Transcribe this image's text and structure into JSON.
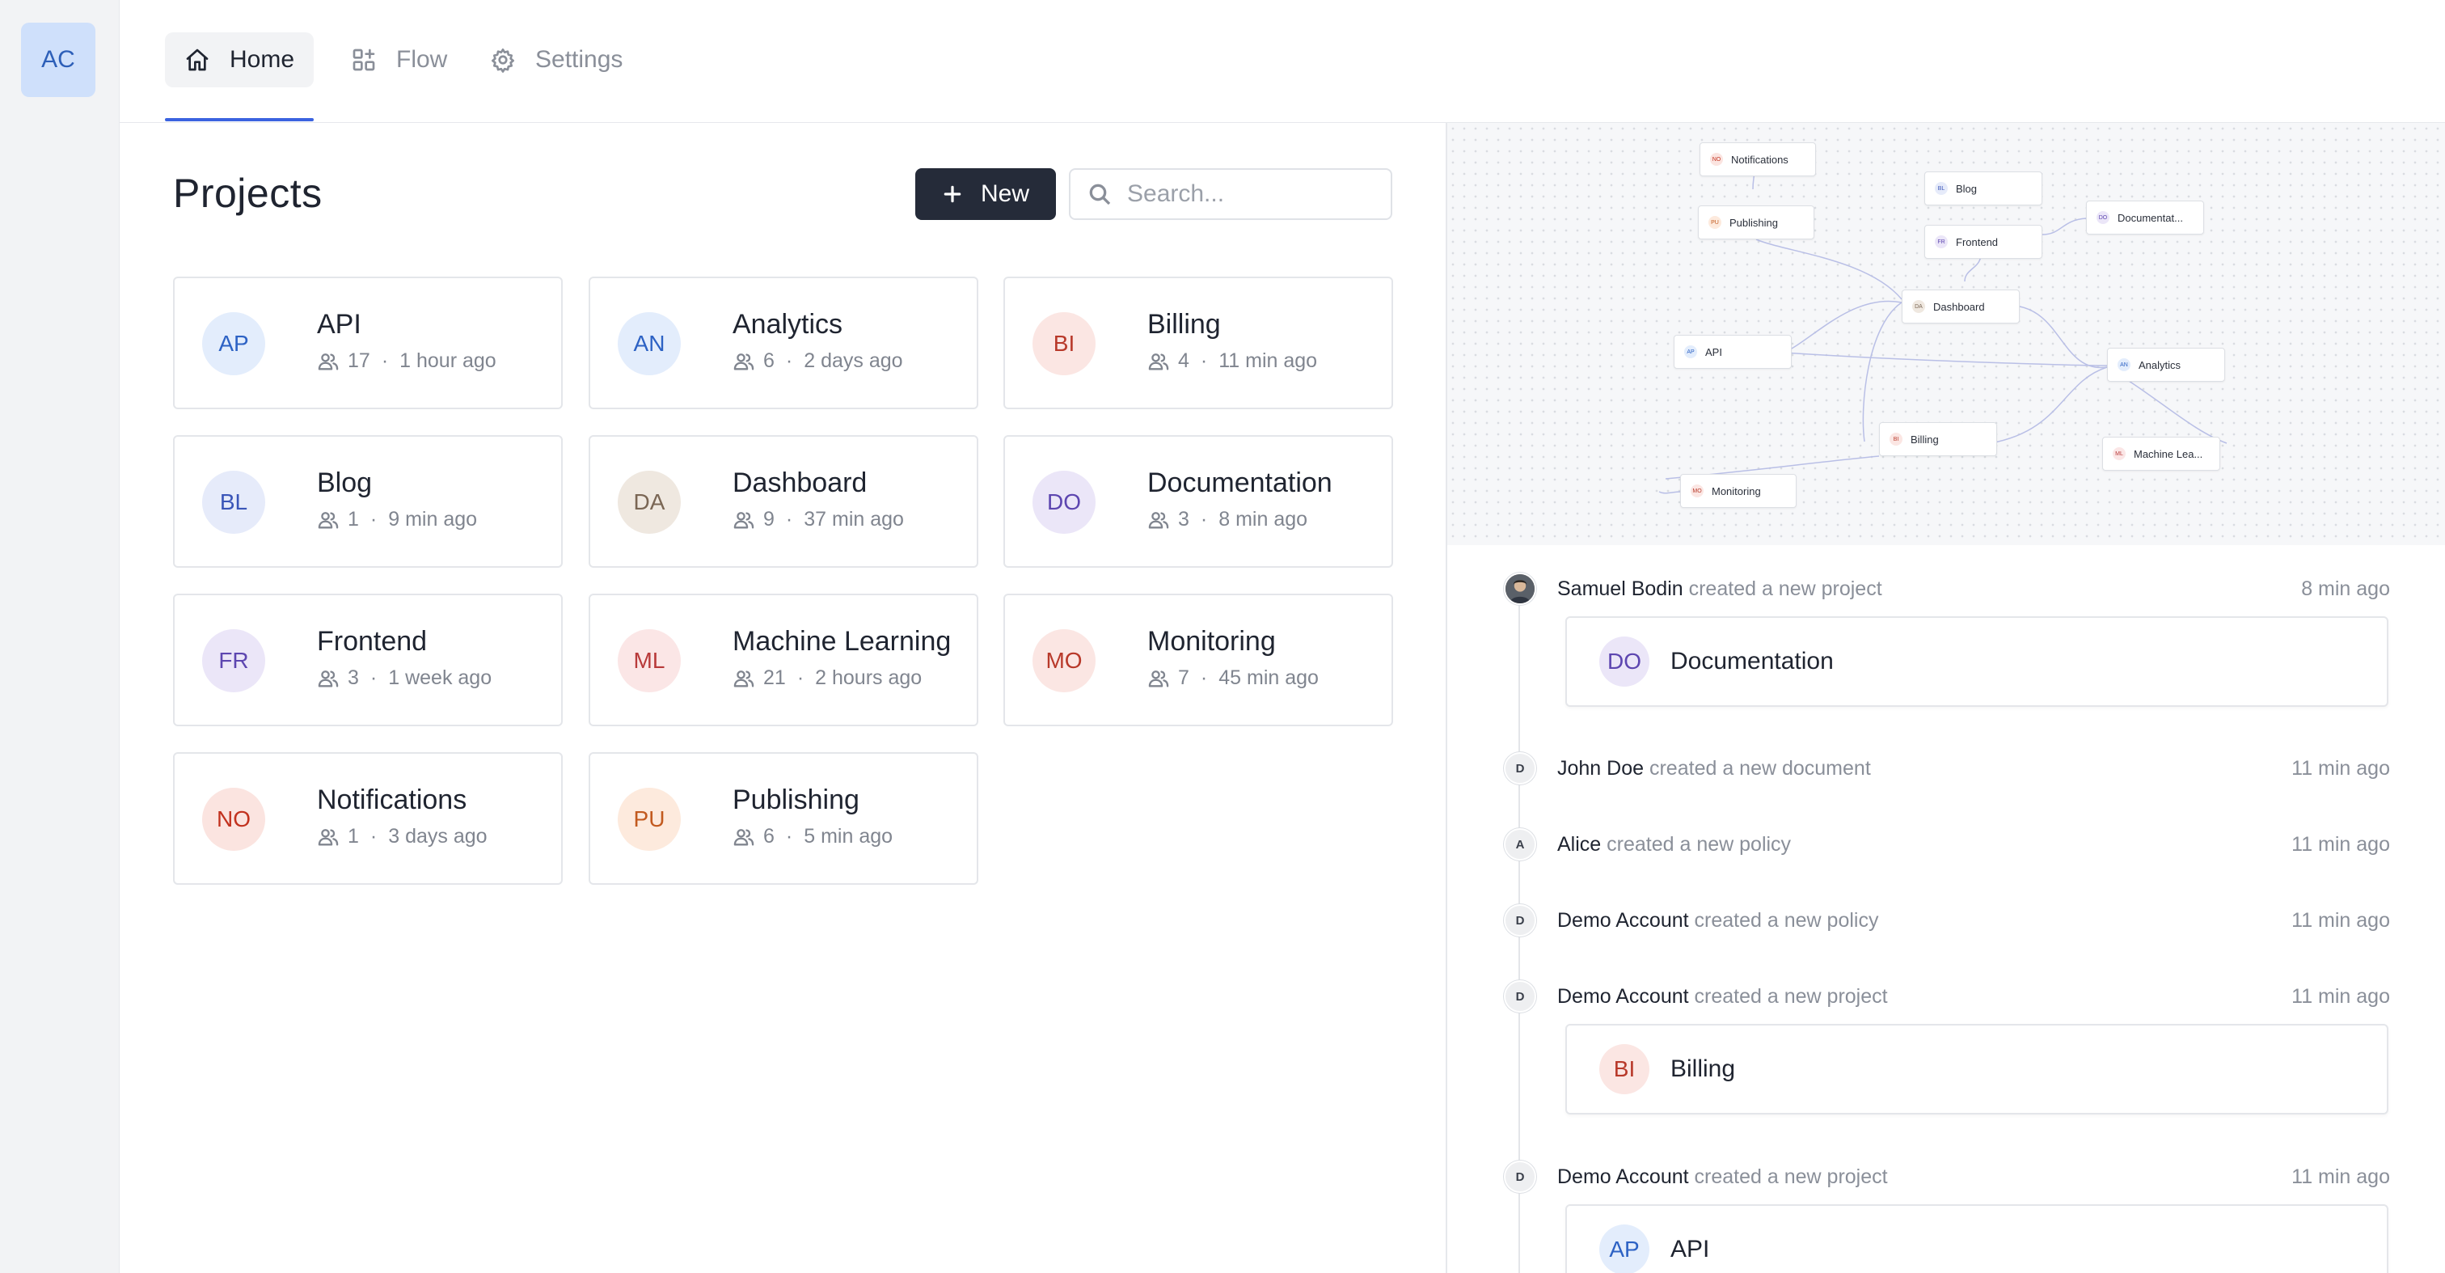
{
  "org": {
    "initials": "AC"
  },
  "nav": {
    "tabs": [
      {
        "label": "Home",
        "icon": "home-icon",
        "active": true
      },
      {
        "label": "Flow",
        "icon": "flow-icon",
        "active": false
      },
      {
        "label": "Settings",
        "icon": "gear-icon",
        "active": false
      }
    ],
    "accent": "#3b63e0"
  },
  "projects": {
    "title": "Projects",
    "new_label": "New",
    "search_placeholder": "Search...",
    "items": [
      {
        "initials": "AP",
        "name": "API",
        "members": "17",
        "time": "1 hour ago",
        "bg": "#e3edfc",
        "fg": "#2d62c4"
      },
      {
        "initials": "AN",
        "name": "Analytics",
        "members": "6",
        "time": "2 days ago",
        "bg": "#e3edfc",
        "fg": "#2d62c4"
      },
      {
        "initials": "BI",
        "name": "Billing",
        "members": "4",
        "time": "11 min ago",
        "bg": "#fbe6e3",
        "fg": "#b8392a"
      },
      {
        "initials": "BL",
        "name": "Blog",
        "members": "1",
        "time": "9 min ago",
        "bg": "#e6ebfa",
        "fg": "#3a55b8"
      },
      {
        "initials": "DA",
        "name": "Dashboard",
        "members": "9",
        "time": "37 min ago",
        "bg": "#efe8e0",
        "fg": "#7a6654"
      },
      {
        "initials": "DO",
        "name": "Documentation",
        "members": "3",
        "time": "8 min ago",
        "bg": "#ebe6f8",
        "fg": "#5d46b0"
      },
      {
        "initials": "FR",
        "name": "Frontend",
        "members": "3",
        "time": "1 week ago",
        "bg": "#ebe6f8",
        "fg": "#5d46b0"
      },
      {
        "initials": "ML",
        "name": "Machine Learning",
        "members": "21",
        "time": "2 hours ago",
        "bg": "#fbe6e6",
        "fg": "#b83a3a"
      },
      {
        "initials": "MO",
        "name": "Monitoring",
        "members": "7",
        "time": "45 min ago",
        "bg": "#fbe6e3",
        "fg": "#b8392a"
      },
      {
        "initials": "NO",
        "name": "Notifications",
        "members": "1",
        "time": "3 days ago",
        "bg": "#fbe4e0",
        "fg": "#c2321f"
      },
      {
        "initials": "PU",
        "name": "Publishing",
        "members": "6",
        "time": "5 min ago",
        "bg": "#fdeadd",
        "fg": "#c25a1f"
      }
    ]
  },
  "flow": {
    "nodes": [
      {
        "initials": "NO",
        "label": "Notifications",
        "fg": "#c2321f",
        "bg": "#fbe4e0"
      },
      {
        "initials": "PU",
        "label": "Publishing",
        "fg": "#c25a1f",
        "bg": "#fdeadd"
      },
      {
        "initials": "BL",
        "label": "Blog",
        "fg": "#3a55b8",
        "bg": "#e6ebfa"
      },
      {
        "initials": "FR",
        "label": "Frontend",
        "fg": "#5d46b0",
        "bg": "#ebe6f8"
      },
      {
        "initials": "DO",
        "label": "Documentat...",
        "fg": "#5d46b0",
        "bg": "#ebe6f8"
      },
      {
        "initials": "DA",
        "label": "Dashboard",
        "fg": "#7a6654",
        "bg": "#efe8e0"
      },
      {
        "initials": "AP",
        "label": "API",
        "fg": "#2d62c4",
        "bg": "#e3edfc"
      },
      {
        "initials": "AN",
        "label": "Analytics",
        "fg": "#2d62c4",
        "bg": "#e3edfc"
      },
      {
        "initials": "BI",
        "label": "Billing",
        "fg": "#b8392a",
        "bg": "#fbe6e3"
      },
      {
        "initials": "ML",
        "label": "Machine Lea...",
        "fg": "#b83a3a",
        "bg": "#fbe6e6"
      },
      {
        "initials": "MO",
        "label": "Monitoring",
        "fg": "#b8392a",
        "bg": "#fbe6e3"
      }
    ]
  },
  "activity": [
    {
      "avatar": "photo",
      "actor": "Samuel Bodin",
      "action": "created a new project",
      "time": "8 min ago",
      "card": {
        "initials": "DO",
        "label": "Documentation",
        "bg": "#ebe6f8",
        "fg": "#5d46b0"
      }
    },
    {
      "avatar": "D",
      "actor": "John Doe",
      "action": "created a new document",
      "time": "11 min ago"
    },
    {
      "avatar": "A",
      "actor": "Alice",
      "action": "created a new policy",
      "time": "11 min ago"
    },
    {
      "avatar": "D",
      "actor": "Demo Account",
      "action": "created a new policy",
      "time": "11 min ago"
    },
    {
      "avatar": "D",
      "actor": "Demo Account",
      "action": "created a new project",
      "time": "11 min ago",
      "card": {
        "initials": "BI",
        "label": "Billing",
        "bg": "#fbe6e3",
        "fg": "#b8392a"
      }
    },
    {
      "avatar": "D",
      "actor": "Demo Account",
      "action": "created a new project",
      "time": "11 min ago",
      "card": {
        "initials": "AP",
        "label": "API",
        "bg": "#e3edfc",
        "fg": "#2d62c4"
      }
    }
  ]
}
